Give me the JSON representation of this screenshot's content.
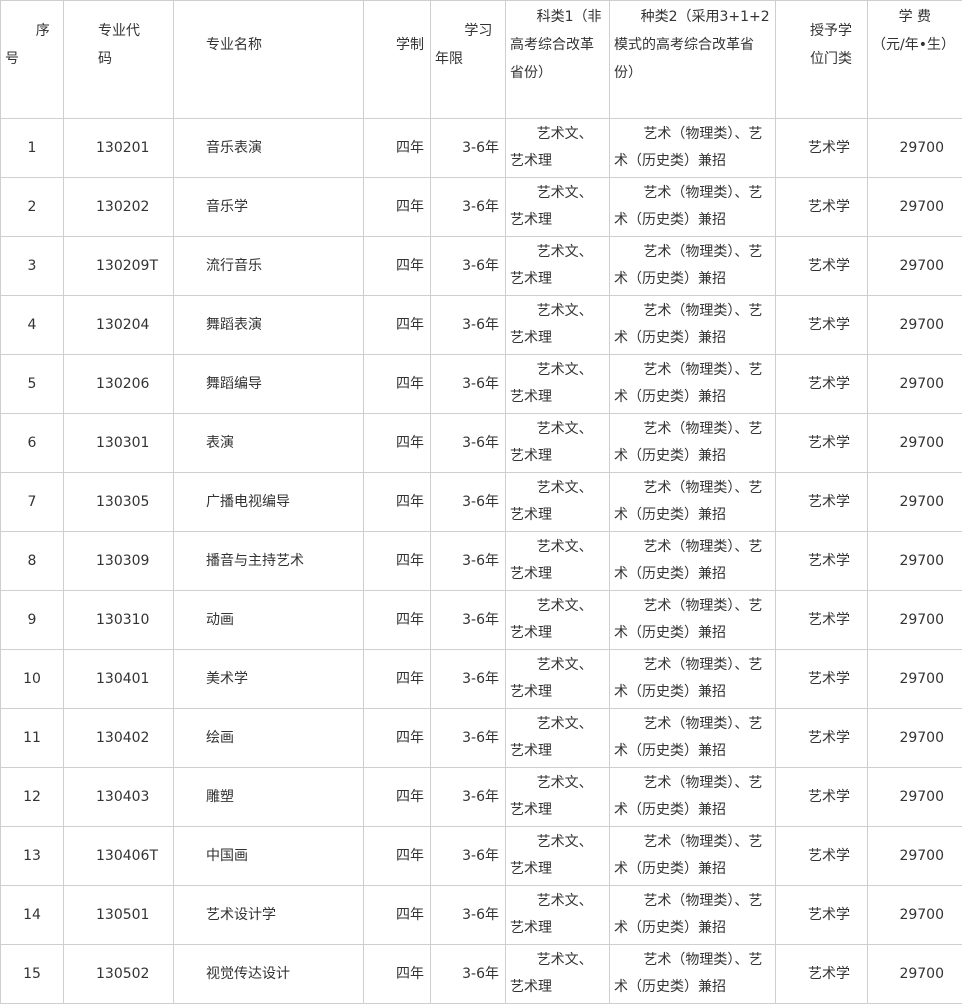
{
  "headers": {
    "seq": "序号",
    "code": "专业代码",
    "name": "专业名称",
    "system": "学制",
    "years": "学习年限",
    "type1": "科类1（非高考综合改革省份）",
    "type2": "种类2（采用3+1+2模式的高考综合改革省份）",
    "degree": "授予学位门类",
    "fee": "学 费（元/年•生）"
  },
  "rows": [
    {
      "seq": "1",
      "code": "130201",
      "name": "音乐表演",
      "system": "四年",
      "years": "3-6年",
      "type1": "艺术文、艺术理",
      "type2": "艺术（物理类）、艺术（历史类）兼招",
      "degree": "艺术学",
      "fee": "29700"
    },
    {
      "seq": "2",
      "code": "130202",
      "name": "音乐学",
      "system": "四年",
      "years": "3-6年",
      "type1": "艺术文、艺术理",
      "type2": "艺术（物理类）、艺术（历史类）兼招",
      "degree": "艺术学",
      "fee": "29700"
    },
    {
      "seq": "3",
      "code": "130209T",
      "name": "流行音乐",
      "system": "四年",
      "years": "3-6年",
      "type1": "艺术文、艺术理",
      "type2": "艺术（物理类）、艺术（历史类）兼招",
      "degree": "艺术学",
      "fee": "29700"
    },
    {
      "seq": "4",
      "code": "130204",
      "name": "舞蹈表演",
      "system": "四年",
      "years": "3-6年",
      "type1": "艺术文、艺术理",
      "type2": "艺术（物理类）、艺术（历史类）兼招",
      "degree": "艺术学",
      "fee": "29700"
    },
    {
      "seq": "5",
      "code": "130206",
      "name": "舞蹈编导",
      "system": "四年",
      "years": "3-6年",
      "type1": "艺术文、艺术理",
      "type2": "艺术（物理类）、艺术（历史类）兼招",
      "degree": "艺术学",
      "fee": "29700"
    },
    {
      "seq": "6",
      "code": "130301",
      "name": "表演",
      "system": "四年",
      "years": "3-6年",
      "type1": "艺术文、艺术理",
      "type2": "艺术（物理类）、艺术（历史类）兼招",
      "degree": "艺术学",
      "fee": "29700"
    },
    {
      "seq": "7",
      "code": "130305",
      "name": "广播电视编导",
      "system": "四年",
      "years": "3-6年",
      "type1": "艺术文、艺术理",
      "type2": "艺术（物理类）、艺术（历史类）兼招",
      "degree": "艺术学",
      "fee": "29700"
    },
    {
      "seq": "8",
      "code": "130309",
      "name": "播音与主持艺术",
      "system": "四年",
      "years": "3-6年",
      "type1": "艺术文、艺术理",
      "type2": "艺术（物理类）、艺术（历史类）兼招",
      "degree": "艺术学",
      "fee": "29700"
    },
    {
      "seq": "9",
      "code": "130310",
      "name": "动画",
      "system": "四年",
      "years": "3-6年",
      "type1": "艺术文、艺术理",
      "type2": "艺术（物理类）、艺术（历史类）兼招",
      "degree": "艺术学",
      "fee": "29700"
    },
    {
      "seq": "10",
      "code": "130401",
      "name": "美术学",
      "system": "四年",
      "years": "3-6年",
      "type1": "艺术文、艺术理",
      "type2": "艺术（物理类）、艺术（历史类）兼招",
      "degree": "艺术学",
      "fee": "29700"
    },
    {
      "seq": "11",
      "code": "130402",
      "name": "绘画",
      "system": "四年",
      "years": "3-6年",
      "type1": "艺术文、艺术理",
      "type2": "艺术（物理类）、艺术（历史类）兼招",
      "degree": "艺术学",
      "fee": "29700"
    },
    {
      "seq": "12",
      "code": "130403",
      "name": "雕塑",
      "system": "四年",
      "years": "3-6年",
      "type1": "艺术文、艺术理",
      "type2": "艺术（物理类）、艺术（历史类）兼招",
      "degree": "艺术学",
      "fee": "29700"
    },
    {
      "seq": "13",
      "code": "130406T",
      "name": "中国画",
      "system": "四年",
      "years": "3-6年",
      "type1": "艺术文、艺术理",
      "type2": "艺术（物理类）、艺术（历史类）兼招",
      "degree": "艺术学",
      "fee": "29700"
    },
    {
      "seq": "14",
      "code": "130501",
      "name": "艺术设计学",
      "system": "四年",
      "years": "3-6年",
      "type1": "艺术文、艺术理",
      "type2": "艺术（物理类）、艺术（历史类）兼招",
      "degree": "艺术学",
      "fee": "29700"
    },
    {
      "seq": "15",
      "code": "130502",
      "name": "视觉传达设计",
      "system": "四年",
      "years": "3-6年",
      "type1": "艺术文、艺术理",
      "type2": "艺术（物理类）、艺术（历史类）兼招",
      "degree": "艺术学",
      "fee": "29700"
    }
  ]
}
